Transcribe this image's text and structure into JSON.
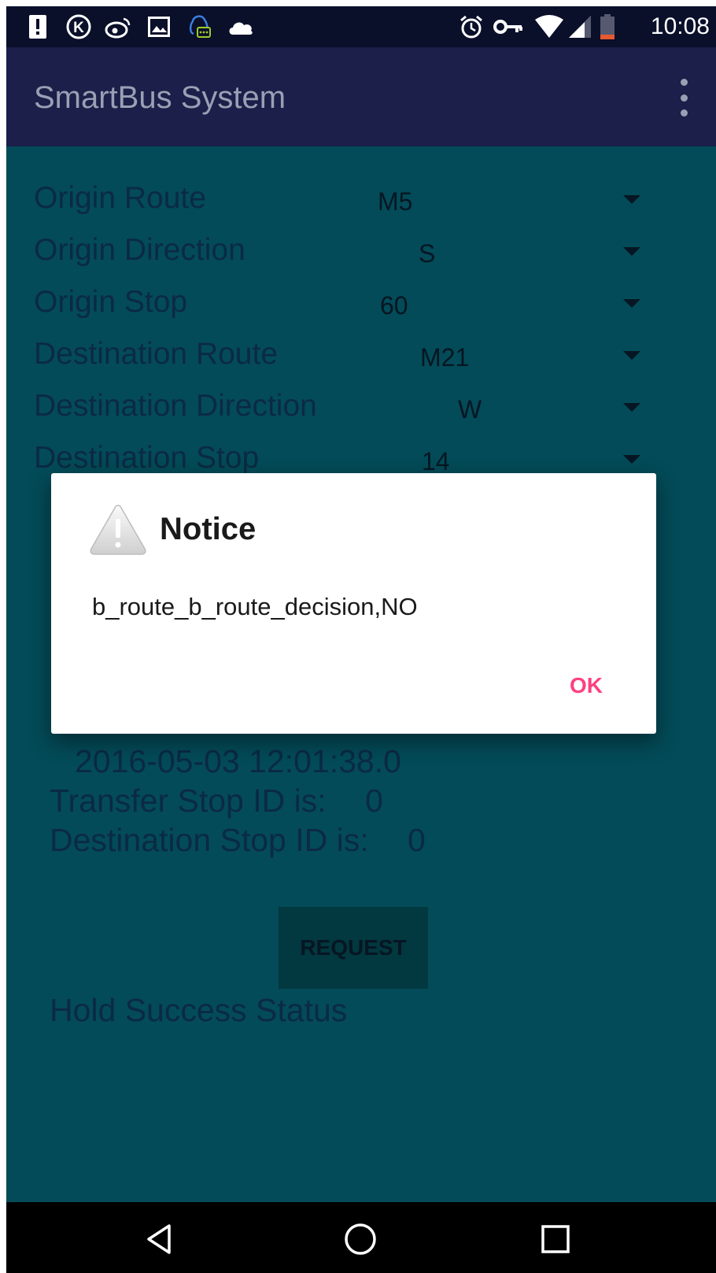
{
  "status_bar": {
    "time": "10:08",
    "left_icons": [
      "alert-icon",
      "k-app-icon",
      "weibo-icon",
      "image-icon",
      "qq-icon",
      "cloud-icon"
    ],
    "right_icons": [
      "alarm-icon",
      "vpn-key-icon",
      "wifi-icon",
      "signal-icon",
      "battery-low-icon"
    ]
  },
  "app_bar": {
    "title": "SmartBus System",
    "menu_icon": "overflow-menu-icon"
  },
  "form": {
    "rows": [
      {
        "label": "Origin Route",
        "value": "M5"
      },
      {
        "label": "Origin Direction",
        "value": "S"
      },
      {
        "label": "Origin Stop",
        "value": "60"
      },
      {
        "label": "Destination Route",
        "value": "M21"
      },
      {
        "label": "Destination Direction",
        "value": "W"
      },
      {
        "label": "Destination Stop",
        "value": "14"
      }
    ]
  },
  "info": {
    "timestamp": "2016-05-03 12:01:38.0",
    "transfer_stop_label": "Transfer Stop ID is:",
    "transfer_stop_value": "0",
    "destination_stop_label": "Destination Stop ID is:",
    "destination_stop_value": "0"
  },
  "request_button": {
    "label": "REQUEST"
  },
  "hold_status": {
    "label": "Hold Success Status"
  },
  "dialog": {
    "icon": "warning-icon",
    "title": "Notice",
    "message": "b_route_b_route_decision,NO",
    "ok_label": "OK"
  },
  "nav_bar": {
    "icons": [
      "back-icon",
      "home-icon",
      "recents-icon"
    ]
  },
  "colors": {
    "status_bar_bg": "#0a0f2a",
    "app_bar_bg": "#1b1f49",
    "content_bg": "#034b58",
    "dialog_accent": "#ff3f80"
  }
}
